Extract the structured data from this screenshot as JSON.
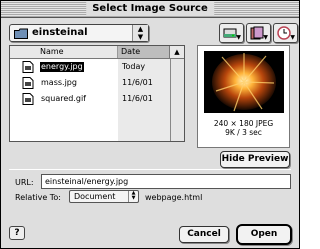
{
  "window": {
    "title": "Select Image Source"
  },
  "folder_popup": {
    "label": "einsteinal"
  },
  "toolbar": {
    "icons": [
      "disk-icon",
      "bookmarks-icon",
      "recent-clock-icon"
    ]
  },
  "file_list": {
    "columns": {
      "name": "Name",
      "date": "Date Modified",
      "sort_glyph": "▲"
    },
    "rows": [
      {
        "name": "energy.jpg",
        "date": "Today",
        "selected": true
      },
      {
        "name": "mass.jpg",
        "date": "11/6/01",
        "selected": false
      },
      {
        "name": "squared.gif",
        "date": "11/6/01",
        "selected": false
      }
    ]
  },
  "preview": {
    "dimensions": "240 × 180 JPEG",
    "size": "9K / 3 sec"
  },
  "buttons": {
    "hide_preview": "Hide Preview",
    "cancel": "Cancel",
    "open": "Open",
    "help": "?"
  },
  "url": {
    "label": "URL:",
    "value": "einsteinal/energy.jpg"
  },
  "relative_to": {
    "label": "Relative To:",
    "selected": "Document",
    "file": "webpage.html"
  }
}
